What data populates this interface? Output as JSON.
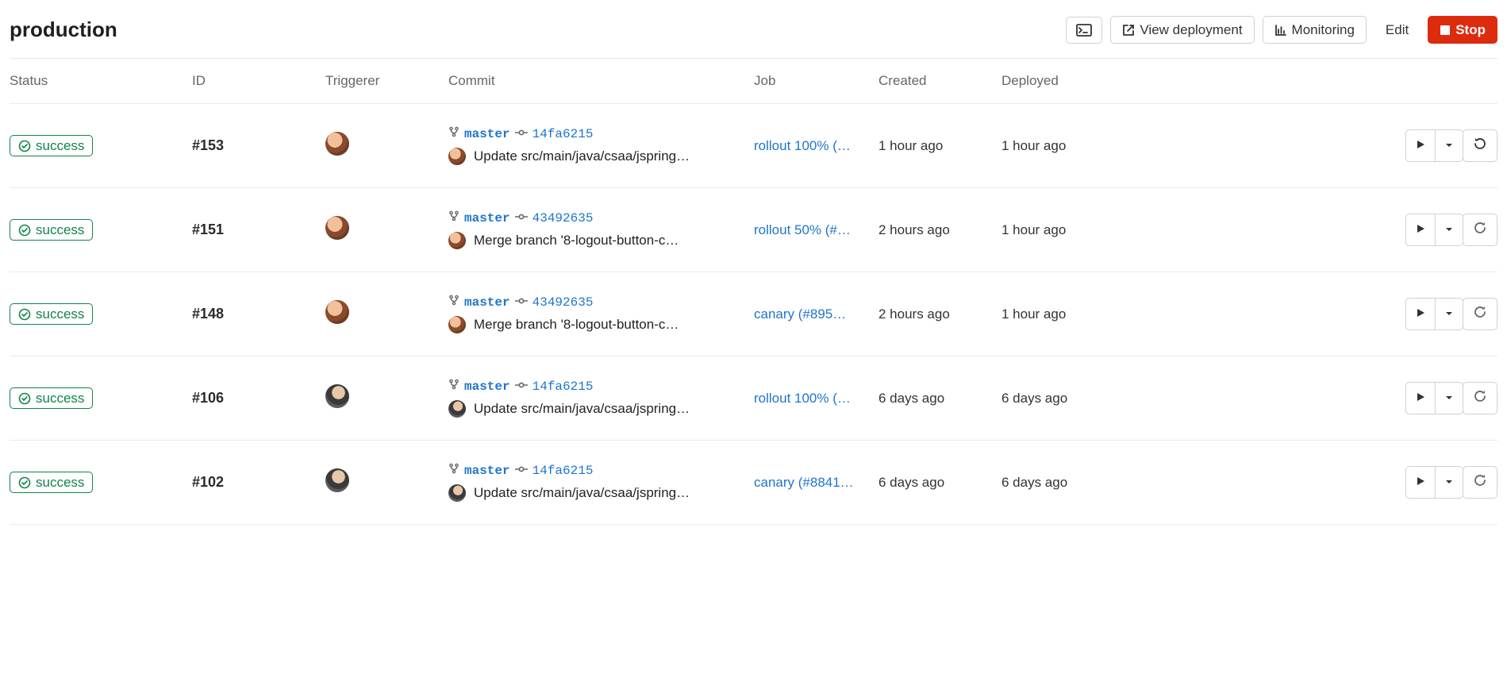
{
  "header": {
    "title": "production",
    "view_deployment": "View deployment",
    "monitoring": "Monitoring",
    "edit": "Edit",
    "stop": "Stop"
  },
  "columns": {
    "status": "Status",
    "id": "ID",
    "triggerer": "Triggerer",
    "commit": "Commit",
    "job": "Job",
    "created": "Created",
    "deployed": "Deployed"
  },
  "rows": [
    {
      "status": "success",
      "id": "#153",
      "triggerer_avatar": "a",
      "branch": "master",
      "sha": "14fa6215",
      "author_avatar": "a",
      "message": "Update src/main/java/csaa/jspring…",
      "job": "rollout 100% (…",
      "created": "1 hour ago",
      "deployed": "1 hour ago",
      "action_icon": "redo"
    },
    {
      "status": "success",
      "id": "#151",
      "triggerer_avatar": "a",
      "branch": "master",
      "sha": "43492635",
      "author_avatar": "a",
      "message": "Merge branch '8-logout-button-c…",
      "job": "rollout 50% (#…",
      "created": "2 hours ago",
      "deployed": "1 hour ago",
      "action_icon": "undo"
    },
    {
      "status": "success",
      "id": "#148",
      "triggerer_avatar": "a",
      "branch": "master",
      "sha": "43492635",
      "author_avatar": "a",
      "message": "Merge branch '8-logout-button-c…",
      "job": "canary (#895…",
      "created": "2 hours ago",
      "deployed": "1 hour ago",
      "action_icon": "undo"
    },
    {
      "status": "success",
      "id": "#106",
      "triggerer_avatar": "b",
      "branch": "master",
      "sha": "14fa6215",
      "author_avatar": "b",
      "message": "Update src/main/java/csaa/jspring…",
      "job": "rollout 100% (…",
      "created": "6 days ago",
      "deployed": "6 days ago",
      "action_icon": "undo"
    },
    {
      "status": "success",
      "id": "#102",
      "triggerer_avatar": "b",
      "branch": "master",
      "sha": "14fa6215",
      "author_avatar": "b",
      "message": "Update src/main/java/csaa/jspring…",
      "job": "canary (#8841…",
      "created": "6 days ago",
      "deployed": "6 days ago",
      "action_icon": "undo"
    }
  ]
}
